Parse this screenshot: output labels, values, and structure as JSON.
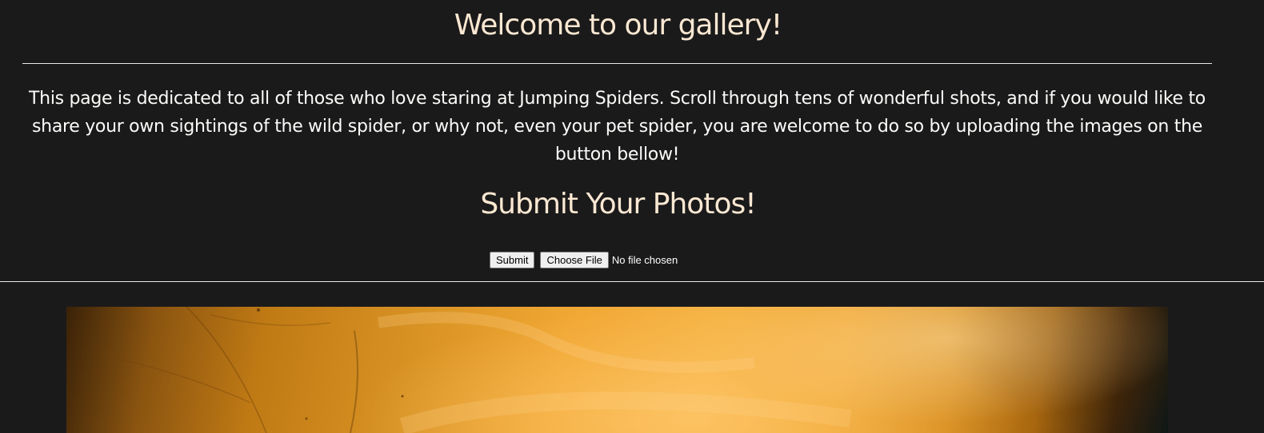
{
  "header": {
    "title": "Welcome to our gallery!"
  },
  "intro": {
    "text": "This page is dedicated to all of those who love staring at Jumping Spiders. Scroll through tens of wonderful shots, and if you would like to share your own sightings of the wild spider, or why not, even your pet spider, you are welcome to do so by uploading the images on the button bellow!"
  },
  "submit_section": {
    "title": "Submit Your Photos!",
    "submit_label": "Submit",
    "choose_file_label": "Choose File",
    "file_status": "No file chosen"
  },
  "gallery": {
    "image_subject": "orange leaf macro photo"
  },
  "colors": {
    "background": "#1b1a1b",
    "heading": "#fbe8d2",
    "text": "#fbfbf8"
  }
}
